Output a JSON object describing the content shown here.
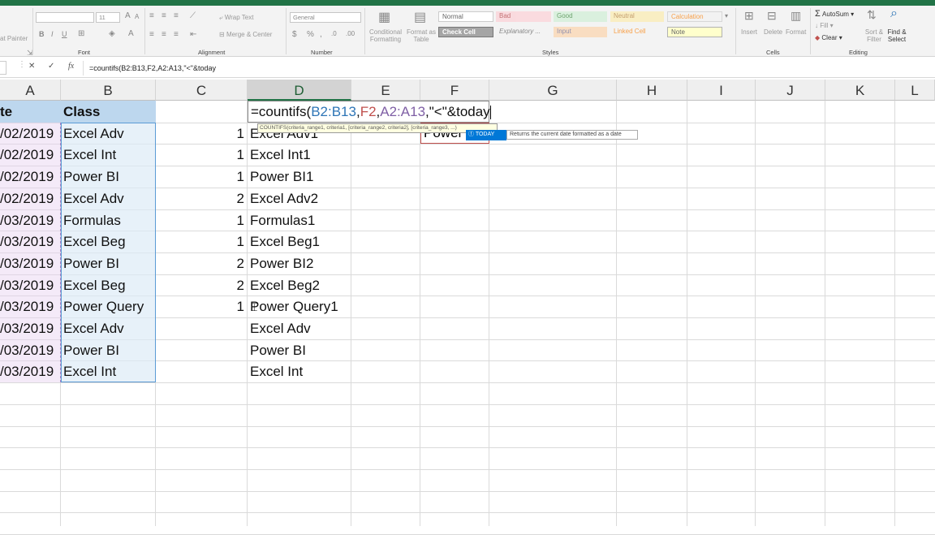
{
  "ribbon": {
    "clipboard_label": "at Painter",
    "font_name": "",
    "font_size": "11",
    "bold": "B",
    "italic": "I",
    "underline": "U",
    "font_group": "Font",
    "wrap_text": "Wrap Text",
    "merge_center": "Merge & Center",
    "alignment_group": "Alignment",
    "number_format": "General",
    "number_group": "Number",
    "conditional_formatting": "Conditional Formatting",
    "format_as_table": "Format as Table",
    "styles": [
      "Normal",
      "Bad",
      "Good",
      "Neutral",
      "Calculation",
      "Check Cell",
      "Explanatory ...",
      "Input",
      "Linked Cell",
      "Note"
    ],
    "styles_group": "Styles",
    "insert": "Insert",
    "delete": "Delete",
    "format": "Format",
    "cells_group": "Cells",
    "autosum": "AutoSum",
    "fill": "Fill",
    "clear": "Clear",
    "sort_filter": "Sort & Filter",
    "find_select": "Find & Select",
    "editing_group": "Editing"
  },
  "formula_bar": {
    "cancel": "✕",
    "enter": "✓",
    "fx": "fx",
    "formula": "=countifs(B2:B13,F2,A2:A13,\"<\"&today"
  },
  "columns": [
    "A",
    "B",
    "C",
    "D",
    "E",
    "F",
    "G",
    "H",
    "I",
    "J",
    "K",
    "L"
  ],
  "rows": [
    {
      "a": "te",
      "b": "Class",
      "c": "",
      "d": ""
    },
    {
      "a": "/02/2019",
      "b": "Excel Adv",
      "c": "1",
      "d": "Excel Adv1"
    },
    {
      "a": "/02/2019",
      "b": "Excel Int",
      "c": "1",
      "d": "Excel Int1"
    },
    {
      "a": "/02/2019",
      "b": "Power BI",
      "c": "1",
      "d": "Power BI1"
    },
    {
      "a": "/02/2019",
      "b": "Excel Adv",
      "c": "2",
      "d": "Excel Adv2"
    },
    {
      "a": "/03/2019",
      "b": "Formulas",
      "c": "1",
      "d": "Formulas1"
    },
    {
      "a": "/03/2019",
      "b": "Excel Beg",
      "c": "1",
      "d": "Excel Beg1"
    },
    {
      "a": "/03/2019",
      "b": "Power BI",
      "c": "2",
      "d": "Power BI2"
    },
    {
      "a": "/03/2019",
      "b": "Excel Beg",
      "c": "2",
      "d": "Excel Beg2"
    },
    {
      "a": "/03/2019",
      "b": "Power Query",
      "c": "1",
      "d": "Power Query1"
    },
    {
      "a": "/03/2019",
      "b": "Excel Adv",
      "c": "",
      "d": "Excel Adv"
    },
    {
      "a": "/03/2019",
      "b": "Power BI",
      "c": "",
      "d": "Power BI"
    },
    {
      "a": "/03/2019",
      "b": "Excel Int",
      "c": "",
      "d": "Excel Int"
    }
  ],
  "editing": {
    "formula_prefix": "=countifs(",
    "ref1": "B2:B13",
    "comma1": ",",
    "ref2": "F2",
    "comma2": ",",
    "ref3": "A2:A13",
    "rest": ",\"<\"&today",
    "tooltip": "COUNTIFS(criteria_range1, criteria1, [criteria_range2, criteria2], [criteria_range3, ...)",
    "f2_value": "Power",
    "autocomplete_item": "TODAY",
    "autocomplete_desc": "Returns the current date formatted as a date"
  },
  "colors": {
    "ref1": "#2e75b6",
    "ref2": "#c0504d",
    "ref3": "#7f5fa5",
    "excel_green": "#217346",
    "header_fill": "#bdd7ee"
  }
}
